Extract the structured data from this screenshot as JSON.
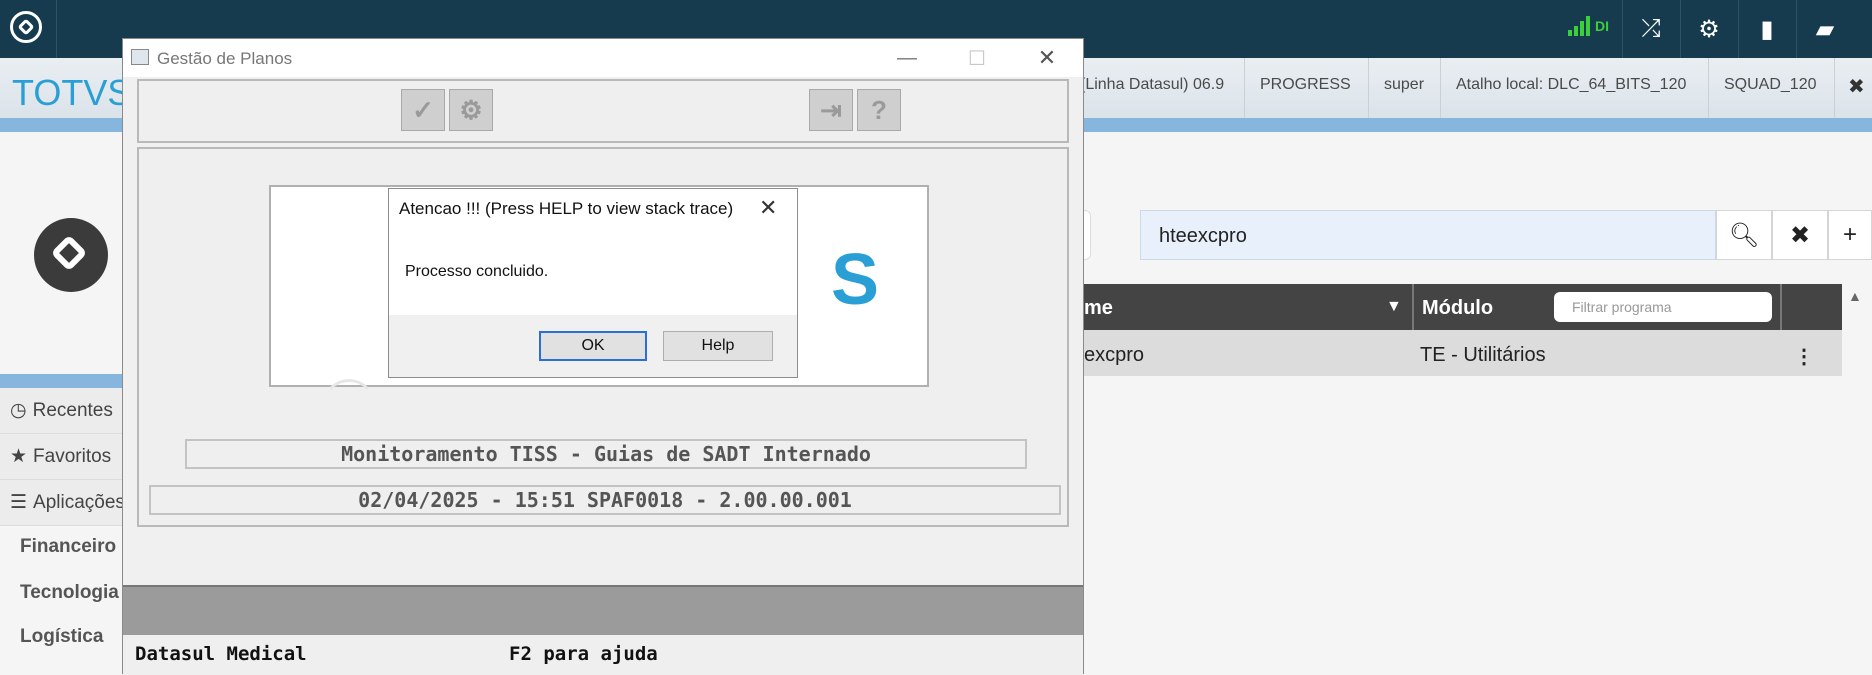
{
  "topbar": {
    "signal_text": "DI",
    "icons": [
      "shuffle-icon",
      "gear-icon",
      "document-icon",
      "chat-icon"
    ]
  },
  "infobar": {
    "brand": "TOTVS",
    "items": [
      "(Linha Datasul) 06.9",
      "PROGRESS",
      "super",
      "Atalho local: DLC_64_BITS_120",
      "SQUAD_120"
    ],
    "close": "✖"
  },
  "sidebar": {
    "items": [
      {
        "icon": "clock-icon",
        "glyph": "◷",
        "label": "Recentes"
      },
      {
        "icon": "star-icon",
        "glyph": "★",
        "label": "Favoritos"
      },
      {
        "icon": "menu-icon",
        "glyph": "☰",
        "label": "Aplicações"
      }
    ],
    "subitems": [
      "Financeiro",
      "Tecnologia",
      "Logística"
    ]
  },
  "search": {
    "value": "hteexcpro",
    "search_glyph": "🔍︎",
    "clear_glyph": "✖",
    "add_glyph": "+"
  },
  "table": {
    "col_name": "me",
    "col_module": "Módulo",
    "filter_placeholder": "Filtrar programa",
    "rows": [
      {
        "name": "excpro",
        "module": "TE - Utilitários",
        "menu": "⋮"
      }
    ]
  },
  "window": {
    "title": "Gestão de Planos",
    "minimize": "—",
    "maximize": "☐",
    "close": "✕",
    "toolbar_glyphs": [
      "✓",
      "⚙",
      "⇥",
      "?"
    ],
    "banner_letter": "S",
    "label_program": "Monitoramento TISS - Guias de SADT Internado",
    "label_info": "02/04/2025 - 15:51  SPAF0018 - 2.00.00.001",
    "status_left": "Datasul Medical",
    "status_right": "F2 para ajuda"
  },
  "dialog": {
    "title": "Atencao !!! (Press HELP to view stack trace)",
    "close": "✕",
    "message": "Processo concluido.",
    "ok_label": "OK",
    "help_label": "Help"
  },
  "colors": {
    "topbar": "#163b4f",
    "brand": "#2a9fd6",
    "accent_strip": "#86b5de",
    "signal": "#3ccf3c"
  }
}
